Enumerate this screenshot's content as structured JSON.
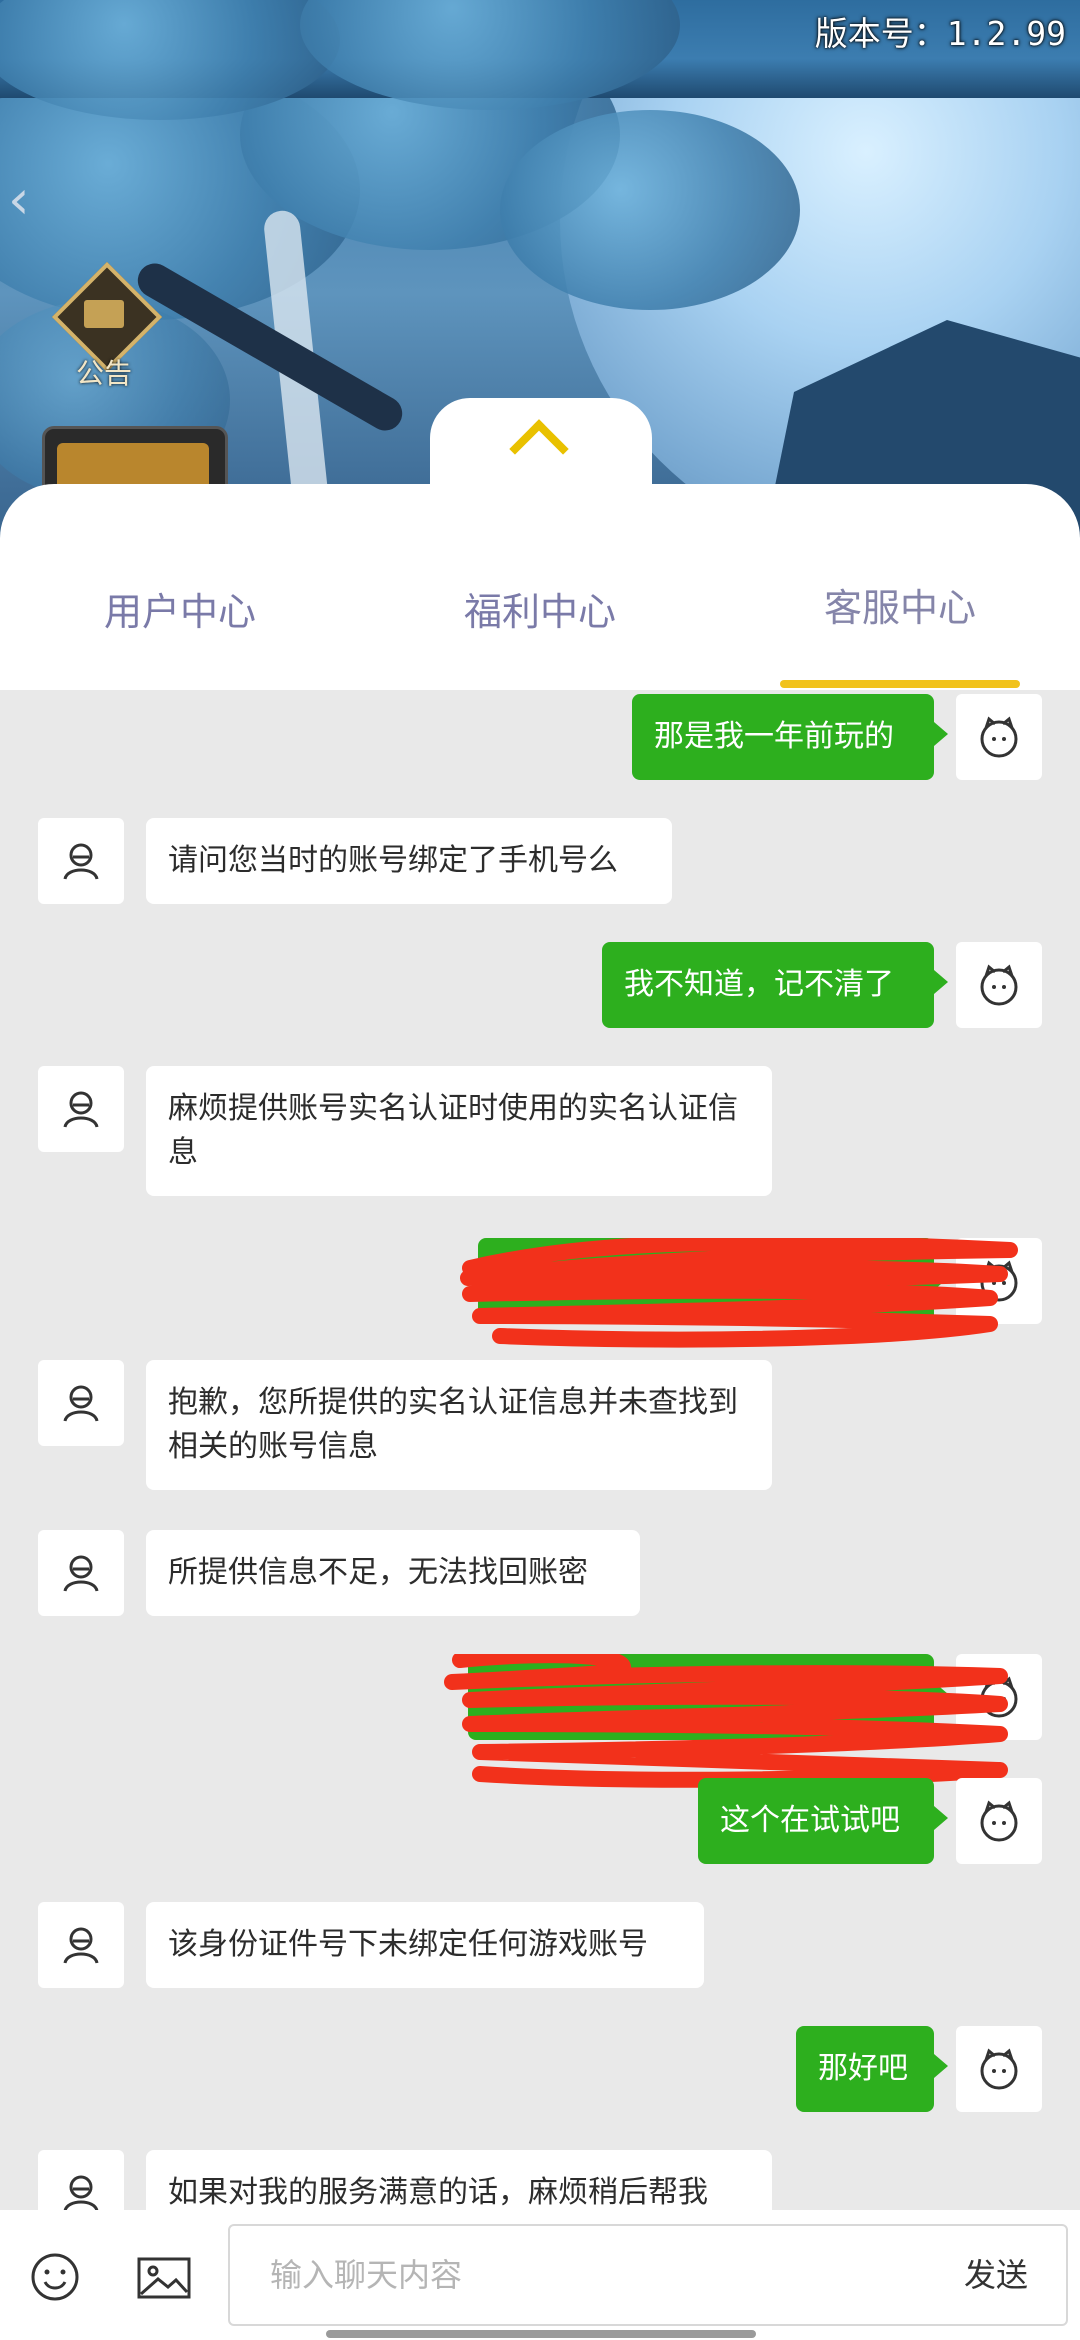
{
  "header": {
    "version_text": "版本号：1.2.99",
    "notice_label": "公告"
  },
  "tabs": [
    {
      "label": "用户中心",
      "active": false
    },
    {
      "label": "福利中心",
      "active": false
    },
    {
      "label": "客服中心",
      "active": true
    }
  ],
  "chat": {
    "messages": [
      {
        "from": "user",
        "text": "那是我一年前玩的",
        "redacted": false
      },
      {
        "from": "agent",
        "text": "请问您当时的账号绑定了手机号么",
        "redacted": false
      },
      {
        "from": "user",
        "text": "我不知道，记不清了",
        "redacted": false
      },
      {
        "from": "agent",
        "text": "麻烦提供账号实名认证时使用的实名认证信息",
        "redacted": false
      },
      {
        "from": "user",
        "text": "",
        "redacted": true
      },
      {
        "from": "agent",
        "text": "抱歉，您所提供的实名认证信息并未查找到相关的账号信息",
        "redacted": false
      },
      {
        "from": "agent",
        "text": "所提供信息不足，无法找回账密",
        "redacted": false
      },
      {
        "from": "user",
        "text": "",
        "redacted": true
      },
      {
        "from": "user",
        "text": "这个在试试吧",
        "redacted": false
      },
      {
        "from": "agent",
        "text": "该身份证件号下未绑定任何游戏账号",
        "redacted": false
      },
      {
        "from": "user",
        "text": "那好吧",
        "redacted": false
      },
      {
        "from": "agent",
        "text": "如果对我的服务满意的话，麻烦稍后帮我",
        "redacted": false
      }
    ]
  },
  "input": {
    "placeholder": "输入聊天内容",
    "send_label": "发送"
  },
  "colors": {
    "user_bubble": "#2daf1e",
    "agent_bubble": "#ffffff",
    "tab_indicator": "#f1c21b",
    "redaction": "#f2311b"
  },
  "icons": {
    "agent_avatar": "person-icon",
    "user_avatar": "face-icon",
    "emoji": "smiley-icon",
    "image": "image-icon",
    "toggle": "chevron-up-icon"
  }
}
